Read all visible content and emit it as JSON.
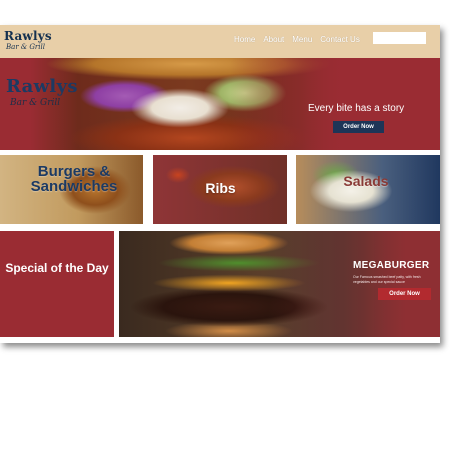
{
  "brand": {
    "name": "Rawlys",
    "subtitle": "Bar & Grill"
  },
  "nav": {
    "items": [
      "Home",
      "About",
      "Menu",
      "Contact Us"
    ]
  },
  "search": {
    "placeholder": ""
  },
  "hero": {
    "tagline": "Every bite has a story",
    "button_label": "Order Now"
  },
  "categories": [
    {
      "title": "Burgers & Sandwiches"
    },
    {
      "title": "Ribs"
    },
    {
      "title": "Salads"
    }
  ],
  "special": {
    "title": "Special of the Day"
  },
  "megaburger": {
    "title": "MEGABURGER",
    "description": "Our Famous smashed beef patty, with fresh vegetables and our special sauce",
    "button_label": "Order Now"
  },
  "colors": {
    "header_bg": "#e8cfa8",
    "brand_red": "#9a2c33",
    "brand_navy": "#1d3557",
    "order_red": "#b22a2f"
  }
}
